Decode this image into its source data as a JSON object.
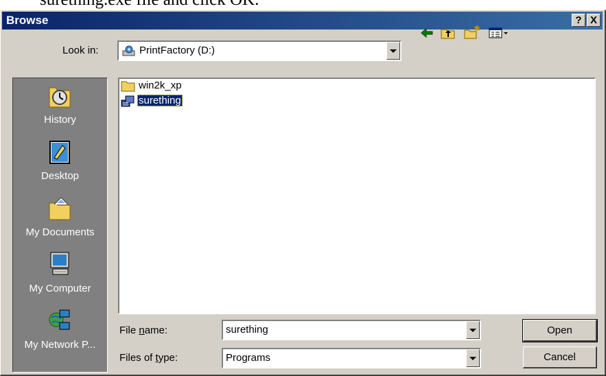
{
  "document_text": "surething.exe file and click OK.",
  "dialog": {
    "title": "Browse",
    "help_button": "?",
    "close_button": "X"
  },
  "toolbar": {
    "look_in_label": "Look in:",
    "look_in_value": "PrintFactory (D:)",
    "icons": [
      "back-icon",
      "up-folder-icon",
      "new-folder-icon",
      "view-menu-icon"
    ]
  },
  "places_bar": [
    {
      "label": "History",
      "icon": "history-icon"
    },
    {
      "label": "Desktop",
      "icon": "desktop-icon"
    },
    {
      "label": "My Documents",
      "icon": "my-documents-icon"
    },
    {
      "label": "My Computer",
      "icon": "my-computer-icon"
    },
    {
      "label": "My Network P...",
      "icon": "my-network-icon"
    }
  ],
  "files": [
    {
      "name": "win2k_xp",
      "type": "folder",
      "selected": false
    },
    {
      "name": "surething",
      "type": "program",
      "selected": true
    }
  ],
  "file_name": {
    "label": "File name:",
    "value": "surething"
  },
  "file_type": {
    "label": "Files of type:",
    "value": "Programs"
  },
  "buttons": {
    "open": "Open",
    "cancel": "Cancel"
  }
}
